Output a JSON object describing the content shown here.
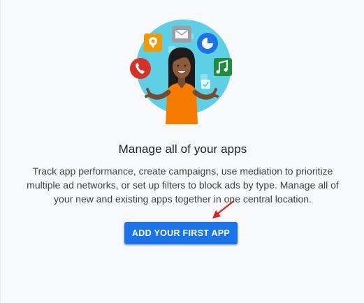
{
  "empty_state": {
    "title": "Manage all of your apps",
    "description": "Track app performance, create campaigns, use mediation to prioritize multiple ad networks, or set up filters to block ads by type. Manage all of your new and existing apps together in one central location.",
    "cta_label": "ADD YOUR FIRST APP"
  },
  "illustration": {
    "icons": [
      "location-pin-icon",
      "mail-icon",
      "pie-chart-icon",
      "phone-icon",
      "music-note-icon",
      "checkbox-icon"
    ]
  },
  "colors": {
    "accent": "#1a73e8",
    "background": "#f8f9fa",
    "annotation_arrow": "#e2231a"
  }
}
